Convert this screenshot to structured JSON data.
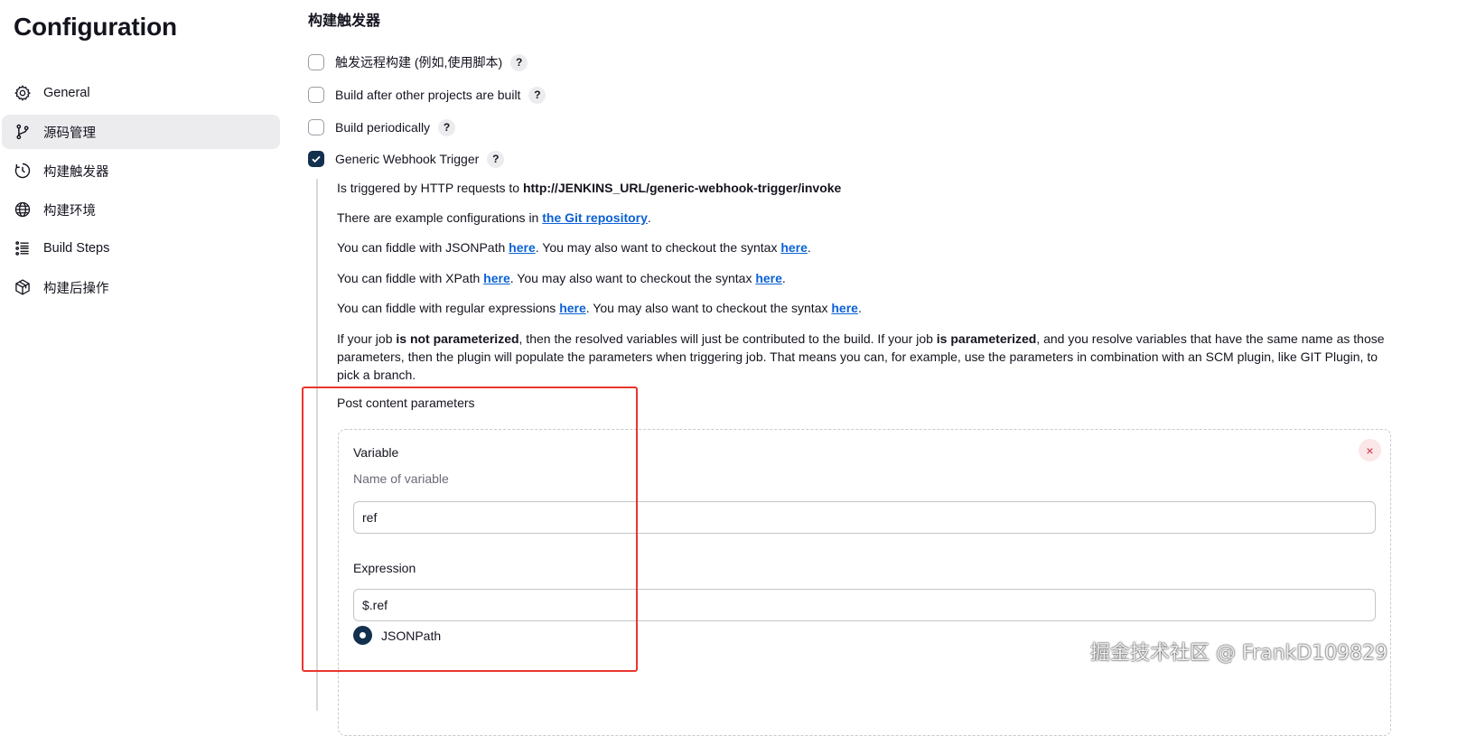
{
  "sidebar": {
    "title": "Configuration",
    "items": [
      {
        "label": "General",
        "icon": "gear-icon"
      },
      {
        "label": "源码管理",
        "icon": "branch-icon",
        "active": true
      },
      {
        "label": "构建触发器",
        "icon": "clock-icon"
      },
      {
        "label": "构建环境",
        "icon": "globe-icon"
      },
      {
        "label": "Build Steps",
        "icon": "list-icon"
      },
      {
        "label": "构建后操作",
        "icon": "box-icon"
      }
    ]
  },
  "main": {
    "section_title": "构建触发器",
    "triggers": [
      {
        "label": "触发远程构建 (例如,使用脚本)",
        "checked": false
      },
      {
        "label": "Build after other projects are built",
        "checked": false
      },
      {
        "label": "Build periodically",
        "checked": false
      },
      {
        "label": "Generic Webhook Trigger",
        "checked": true
      }
    ],
    "help_label": "?",
    "webhook": {
      "triggered_prefix": "Is triggered by HTTP requests to ",
      "triggered_url": "http://JENKINS_URL/generic-webhook-trigger/invoke",
      "example_prefix": "There are example configurations in ",
      "example_link": "the Git repository",
      "example_suffix": ".",
      "jsonpath_prefix": "You can fiddle with JSONPath ",
      "xpath_prefix": "You can fiddle with XPath ",
      "regex_prefix": "You can fiddle with regular expressions ",
      "here_link": "here",
      "syntax_middle": ". You may also want to checkout the syntax ",
      "period": ".",
      "param_p1": "If your job ",
      "param_b1": "is not parameterized",
      "param_p2": ", then the resolved variables will just be contributed to the build. If your job ",
      "param_b2": "is parameterized",
      "param_p3": ", and you resolve variables that have the same name as those parameters, then the plugin will populate the parameters when triggering job. That means you can, for example, use the parameters in combination with an SCM plugin, like GIT Plugin, to pick a branch."
    },
    "post_content": {
      "label": "Post content parameters",
      "delete_label": "×",
      "variable_label": "Variable",
      "variable_desc": "Name of variable",
      "variable_value": "ref",
      "expression_label": "Expression",
      "expression_value": "$.ref",
      "expression_type": "JSONPath"
    }
  },
  "watermark": "掘金技术社区 @ FrankD109829",
  "colors": {
    "accent": "#14304f",
    "link": "#0b61d6",
    "highlight_box": "#e8362e",
    "active_nav_bg": "#ececef"
  }
}
